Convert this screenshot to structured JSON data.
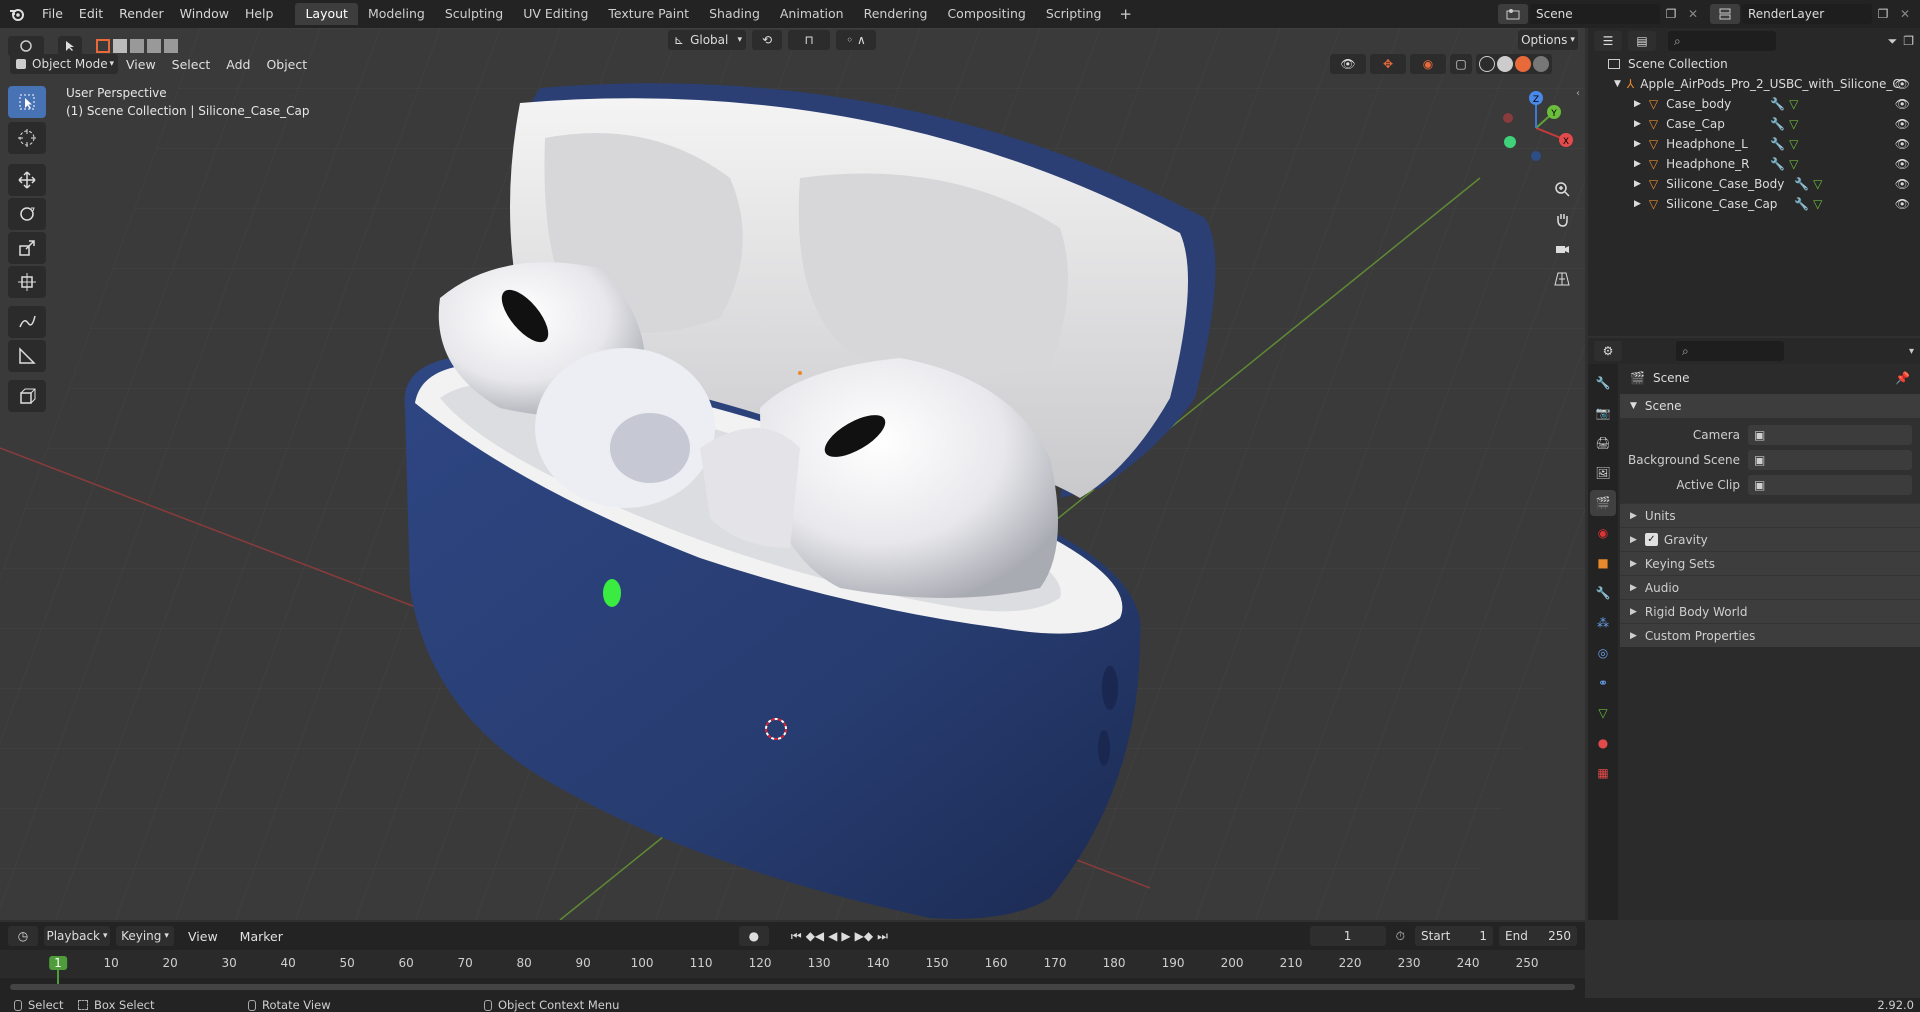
{
  "topbar": {
    "menus": [
      "File",
      "Edit",
      "Render",
      "Window",
      "Help"
    ],
    "workspaces": [
      "Layout",
      "Modeling",
      "Sculpting",
      "UV Editing",
      "Texture Paint",
      "Shading",
      "Animation",
      "Rendering",
      "Compositing",
      "Scripting"
    ],
    "active_workspace": "Layout",
    "add_tab": "+",
    "scene_name": "Scene",
    "view_layer": "RenderLayer"
  },
  "viewport": {
    "mode": "Object Mode",
    "menus": [
      "View",
      "Select",
      "Add",
      "Object"
    ],
    "transform_orientation": "Global",
    "options_label": "Options",
    "view_name": "User Perspective",
    "collection_info": "(1) Scene Collection | Silicone_Case_Cap",
    "gizmo_axes": [
      "X",
      "Y",
      "Z"
    ]
  },
  "outliner": {
    "root": "Scene Collection",
    "collection": "Apple_AirPods_Pro_2_USBC_with_Silicone_C",
    "objects": [
      "Case_body",
      "Case_Cap",
      "Headphone_L",
      "Headphone_R",
      "Silicone_Case_Body",
      "Silicone_Case_Cap"
    ]
  },
  "properties": {
    "header": "Scene",
    "panel": "Scene",
    "fields": [
      {
        "label": "Camera",
        "value": ""
      },
      {
        "label": "Background Scene",
        "value": ""
      },
      {
        "label": "Active Clip",
        "value": ""
      }
    ],
    "sections": [
      {
        "label": "Units",
        "checkbox": false
      },
      {
        "label": "Gravity",
        "checkbox": true
      },
      {
        "label": "Keying Sets",
        "checkbox": false
      },
      {
        "label": "Audio",
        "checkbox": false
      },
      {
        "label": "Rigid Body World",
        "checkbox": false
      },
      {
        "label": "Custom Properties",
        "checkbox": false
      }
    ]
  },
  "timeline": {
    "menus": [
      "Playback",
      "Keying",
      "View",
      "Marker"
    ],
    "current_frame": "1",
    "start_label": "Start",
    "start_value": "1",
    "end_label": "End",
    "end_value": "250",
    "ticks": [
      "1",
      "10",
      "20",
      "30",
      "40",
      "50",
      "60",
      "70",
      "80",
      "90",
      "100",
      "110",
      "120",
      "130",
      "140",
      "150",
      "160",
      "170",
      "180",
      "190",
      "200",
      "210",
      "220",
      "230",
      "240",
      "250"
    ]
  },
  "statusbar": {
    "items": [
      "Select",
      "Box Select",
      "Rotate View",
      "Object Context Menu"
    ],
    "version": "2.92.0"
  },
  "colors": {
    "accent": "#4772b3",
    "case_blue": "#2b3f74",
    "object_orange": "#e88a2c",
    "frame_green": "#4f9d3a"
  }
}
